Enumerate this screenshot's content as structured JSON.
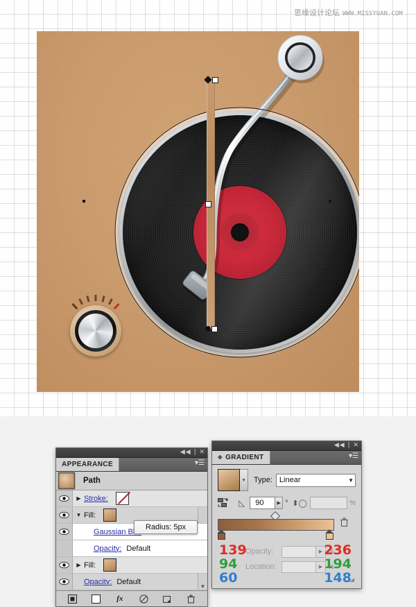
{
  "watermark": {
    "cn": "思缘设计论坛",
    "url": "WWW.MISSYUAN.COM"
  },
  "artwork": {
    "name": "vinyl-turntable-illustration",
    "background_color": "#c99a6c",
    "record_label_color": "#c8283a",
    "disc_color": "#1d1d1d",
    "tonearm_color": "#c9ced3",
    "knob_tick_count": 7
  },
  "appearance_panel": {
    "tab_label": "APPEARANCE",
    "collapse_icon": "collapse-icon",
    "close_icon": "close-icon",
    "menu_icon": "panel-menu-icon",
    "object_name": "Path",
    "rows": [
      {
        "label": "Stroke:",
        "value": "",
        "swatch": "none",
        "twist": "right"
      },
      {
        "label": "Fill:",
        "value": "",
        "swatch": "gradient",
        "twist": "down"
      },
      {
        "label": "Gaussian Blur",
        "value": "",
        "swatch": "",
        "twist": ""
      },
      {
        "label": "Opacity:",
        "value": "Default",
        "swatch": "",
        "twist": ""
      },
      {
        "label": "Fill:",
        "value": "",
        "swatch": "gradient",
        "twist": "right"
      },
      {
        "label": "Opacity:",
        "value": "Default",
        "swatch": "",
        "twist": ""
      }
    ],
    "tooltip": "Radius: 5px",
    "footer_icons": [
      "add-new-stroke-icon",
      "add-new-fill-icon",
      "add-new-effect-icon",
      "clear-appearance-icon",
      "duplicate-item-icon",
      "delete-item-icon"
    ]
  },
  "gradient_panel": {
    "tab_label": "GRADIENT",
    "collapse_icon": "collapse-icon",
    "close_icon": "close-icon",
    "menu_icon": "panel-menu-icon",
    "type_label": "Type:",
    "type_value": "Linear",
    "angle_value": "90",
    "angle_unit": "°",
    "aspect_value": "",
    "aspect_unit": "%",
    "opacity_label": "Opacity:",
    "opacity_value": "",
    "opacity_unit": "%",
    "location_label": "Location:",
    "location_value": "",
    "location_unit": "%",
    "reverse_icon": "reverse-gradient-icon",
    "delete_stop_icon": "delete-stop-icon",
    "stops": [
      {
        "position": 0,
        "color": "#8b5e3c",
        "r": "139",
        "g": "94",
        "b": "60"
      },
      {
        "position": 100,
        "color": "#ecc294",
        "r": "236",
        "g": "194",
        "b": "148"
      }
    ]
  }
}
